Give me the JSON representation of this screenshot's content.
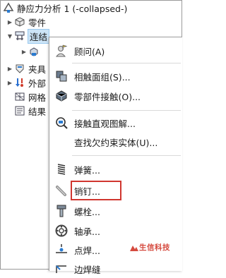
{
  "tree": {
    "study_title": "静应力分析 1 (-collapsed-)",
    "items": [
      {
        "label": "零件"
      },
      {
        "label": "连结"
      },
      {
        "label": "夹具"
      },
      {
        "label": "外部"
      },
      {
        "label": "网格"
      },
      {
        "label": "结果"
      }
    ]
  },
  "context_menu": {
    "items": [
      {
        "label": "顾问(A)"
      },
      {
        "label": "相触面组(S)..."
      },
      {
        "label": "零部件接触(O)..."
      },
      {
        "label": "接触直观图解..."
      },
      {
        "label": "查找欠约束实体(U)..."
      },
      {
        "label": "弹簧..."
      },
      {
        "label": "销钉..."
      },
      {
        "label": "螺栓..."
      },
      {
        "label": "轴承..."
      },
      {
        "label": "点焊..."
      },
      {
        "label": "边焊缝"
      }
    ]
  },
  "watermark": {
    "text": "生信科技"
  },
  "colors": {
    "highlight_box": "#d0362f",
    "selection": "#cce4f7",
    "watermark": "#d54a3f"
  }
}
